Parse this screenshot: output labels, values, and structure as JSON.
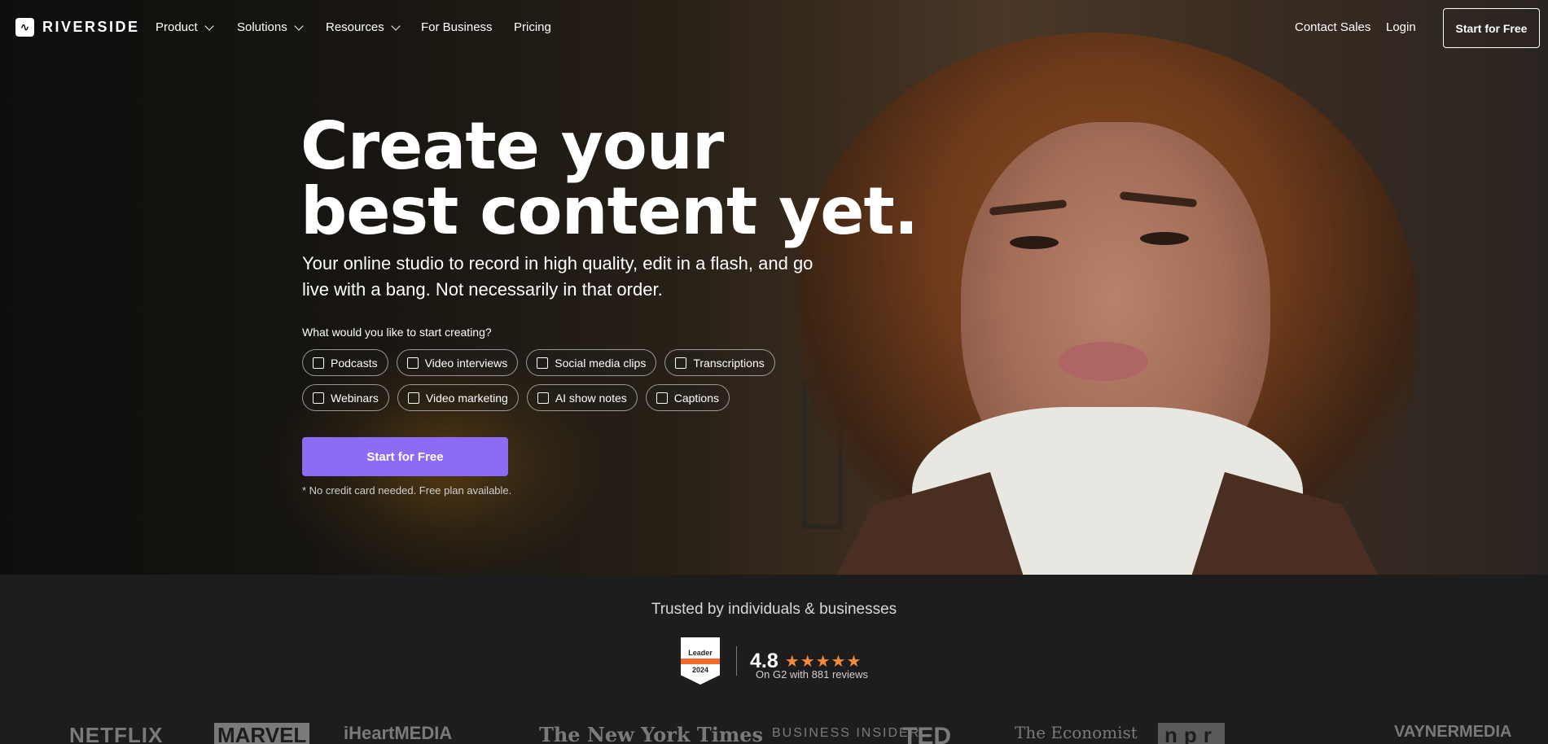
{
  "brand": {
    "name": "RIVERSIDE"
  },
  "nav": {
    "items": [
      {
        "label": "Product",
        "has_dropdown": true
      },
      {
        "label": "Solutions",
        "has_dropdown": true
      },
      {
        "label": "Resources",
        "has_dropdown": true
      },
      {
        "label": "For Business",
        "has_dropdown": false
      },
      {
        "label": "Pricing",
        "has_dropdown": false
      }
    ],
    "contact_sales": "Contact Sales",
    "login": "Login",
    "start_free": "Start for Free"
  },
  "hero": {
    "headline_line1": "Create your",
    "headline_line2": "best content yet.",
    "subheading": "Your online studio to record in high quality, edit in a flash, and go live with a bang. Not necessarily in that order.",
    "question": "What would you like to start creating?",
    "options_row1": [
      "Podcasts",
      "Video interviews",
      "Social media clips",
      "Transcriptions"
    ],
    "options_row2": [
      "Webinars",
      "Video marketing",
      "AI show notes",
      "Captions"
    ],
    "cta": "Start for Free",
    "note": "* No credit card needed. Free plan available."
  },
  "trust": {
    "title": "Trusted by individuals & businesses",
    "badge_label": "Leader",
    "badge_year": "2024",
    "rating": "4.8",
    "stars": "★★★★★",
    "reviews": "On G2 with 881 reviews"
  },
  "logos": [
    "NETFLIX",
    "MARVEL",
    "iHeartMEDIA",
    "The New York Times",
    "BUSINESS INSIDER",
    "TED",
    "The Economist",
    "npr",
    "VAYNERMEDIA"
  ],
  "colors": {
    "accent": "#8c6cf5",
    "star": "#f58a3c",
    "background": "#1d1d1d"
  }
}
